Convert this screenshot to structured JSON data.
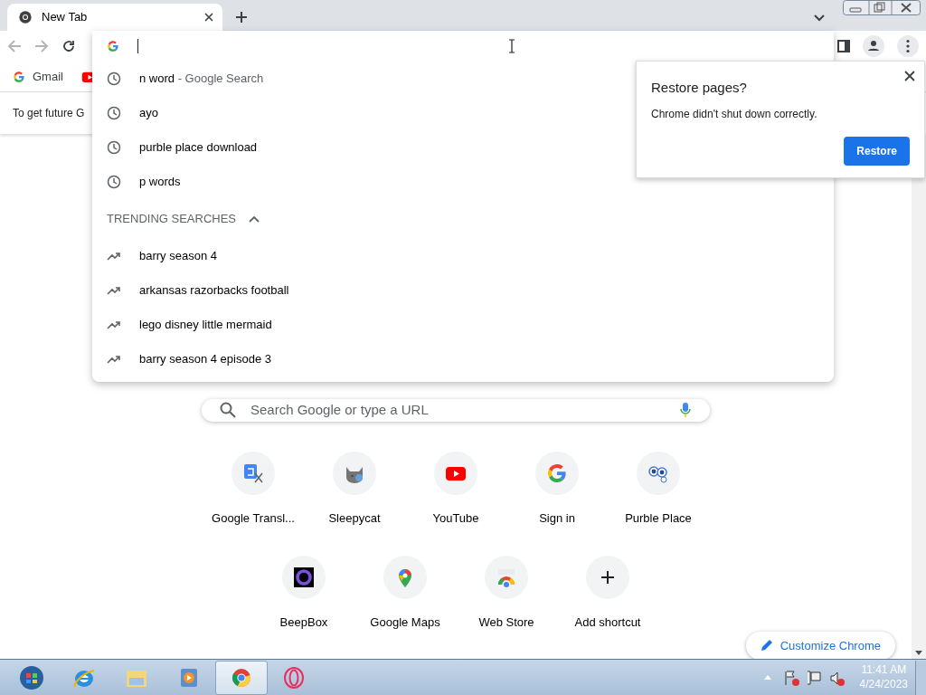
{
  "tab": {
    "title": "New Tab",
    "selected": true
  },
  "bookmarks": [
    {
      "label": "Gmail",
      "kind": "google"
    },
    {
      "kind": "youtube"
    }
  ],
  "infobar": {
    "text": "To get future G"
  },
  "suggestions": [
    {
      "kind": "history",
      "text": "n word",
      "suffix": "- Google Search"
    },
    {
      "kind": "history",
      "text": "ayo"
    },
    {
      "kind": "history",
      "text": "purble place download"
    },
    {
      "kind": "history",
      "text": "p words"
    }
  ],
  "trending": {
    "heading": "TRENDING SEARCHES",
    "expanded": true,
    "items": [
      {
        "text": "barry season 4"
      },
      {
        "text": "arkansas razorbacks football"
      },
      {
        "text": "lego disney little mermaid"
      },
      {
        "text": "barry season 4 episode 3"
      }
    ]
  },
  "restore_popup": {
    "title": "Restore pages?",
    "message": "Chrome didn't shut down correctly.",
    "button": "Restore"
  },
  "search": {
    "placeholder": "Search Google or type a URL"
  },
  "shortcuts": [
    {
      "label": "Google Transl...",
      "kind": "translate"
    },
    {
      "label": "Sleepycat",
      "kind": "cat"
    },
    {
      "label": "YouTube",
      "kind": "youtube"
    },
    {
      "label": "Sign in",
      "kind": "google"
    },
    {
      "label": "Purble Place",
      "kind": "eyes"
    },
    {
      "label": "BeepBox",
      "kind": "ring"
    },
    {
      "label": "Google Maps",
      "kind": "maps"
    },
    {
      "label": "Web Store",
      "kind": "store"
    },
    {
      "label": "Add shortcut",
      "kind": "add"
    }
  ],
  "customize_button": "Customize Chrome",
  "taskbar": {
    "apps": [
      {
        "kind": "start",
        "selected": false
      },
      {
        "kind": "ie",
        "selected": false
      },
      {
        "kind": "folder",
        "selected": false
      },
      {
        "kind": "media",
        "selected": false
      },
      {
        "kind": "chrome",
        "selected": true
      },
      {
        "kind": "opera",
        "selected": false
      }
    ],
    "time": "11:41 AM",
    "date": "4/24/2023"
  }
}
